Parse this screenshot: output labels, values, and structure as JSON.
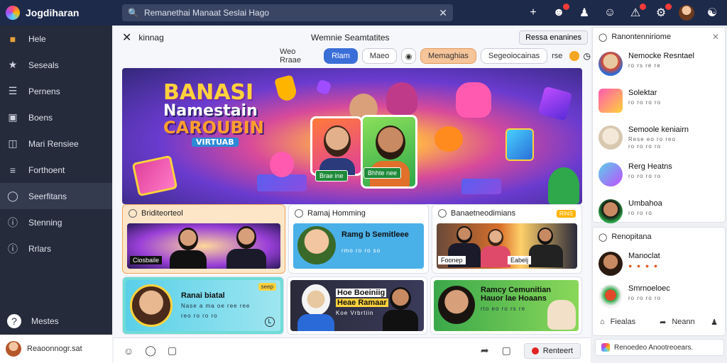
{
  "app": {
    "title": "Jogdiharan"
  },
  "search": {
    "value": "Remanethai Manaat Seslai Hago"
  },
  "sidebar": {
    "items": [
      {
        "label": "Hele",
        "icon": "folder-icon"
      },
      {
        "label": "Seseals",
        "icon": "star-icon"
      },
      {
        "label": "Pernens",
        "icon": "list-icon"
      },
      {
        "label": "Boens",
        "icon": "box-icon"
      },
      {
        "label": "Mari Rensiee",
        "icon": "folder-icon"
      },
      {
        "label": "Forthoent",
        "icon": "menu-icon"
      },
      {
        "label": "Seerfitans",
        "icon": "globe-icon"
      },
      {
        "label": "Stenning",
        "icon": "info-icon"
      },
      {
        "label": "Rrlars",
        "icon": "info-icon"
      }
    ],
    "bottom_label": "Mestes",
    "user_label": "Reaoonnogr.sat"
  },
  "panel": {
    "title": "kinnag",
    "center_title": "Wemnie Seamtatites",
    "right_button": "Ressa enanines"
  },
  "filters": {
    "label": "Weo Rraae",
    "chips": [
      "Rlam",
      "Maeo",
      "",
      "Memaghias",
      "Segeoiocainas",
      ""
    ],
    "trailing_text": "rse"
  },
  "banner": {
    "line1": "BANASI",
    "line2": "Namestain",
    "line3": "CAROUBIN",
    "line4": "VIRTUAB",
    "tag1": "Brae ine",
    "tag2": "Bhhte nee"
  },
  "tiles": [
    {
      "header": "Briditeorteol",
      "caption": "Ciosbaile"
    },
    {
      "header": "Ramaj Homming",
      "title": "Ramg b Semitleee",
      "meta": "rmo ro ro so"
    },
    {
      "header": "Banaetneodimians",
      "badge": "RINS",
      "caption1": "Foonep",
      "caption2": "Eabelj"
    },
    {
      "badge": "seep",
      "title": "Ranai biatal",
      "meta1": "Nase a ma oe ree ree",
      "meta2": "reo ro ro ro"
    },
    {
      "title1": "Hoe Boeiniig",
      "title2": "Heae Ramaar",
      "meta": "Koe Vrbrtiin"
    },
    {
      "title1": "Ramcy Cemunitian",
      "title2": "Hauor lae Hoaans",
      "meta": "rto eo ro rs re"
    }
  ],
  "composer": {
    "send_label": "Renteert"
  },
  "right_panel_1": {
    "title": "Ranontenniriome",
    "items": [
      {
        "name": "Nemocke Resntael",
        "sub1": "ro rs re re",
        "sub2": ""
      },
      {
        "name": "Solektar",
        "sub1": "ro ro ro ro",
        "sub2": ""
      },
      {
        "name": "Semoole keniairn",
        "sub1": "Rese eo ro reo",
        "sub2": "ro ro ro ro"
      },
      {
        "name": "Rerg Heatns",
        "sub1": "ro ro ro ro",
        "sub2": ""
      },
      {
        "name": "Umbahoa",
        "sub1": "ro ro ro",
        "sub2": ""
      }
    ]
  },
  "right_panel_2": {
    "title": "Renopitana",
    "items": [
      {
        "name": "Manoclat",
        "sub1": "● ● ● ●"
      },
      {
        "name": "Smrnoeloec",
        "sub1": "ro ro ro ro"
      }
    ],
    "actions": [
      "Fiealas",
      "Neann"
    ]
  },
  "right_footer": "Renoedeo Anootreoears.",
  "colors": {
    "topbar": "#1e2a4a",
    "sidebar": "#252b3a",
    "accent_blue": "#3b6fd8",
    "accent_orange": "#f7c59a"
  }
}
